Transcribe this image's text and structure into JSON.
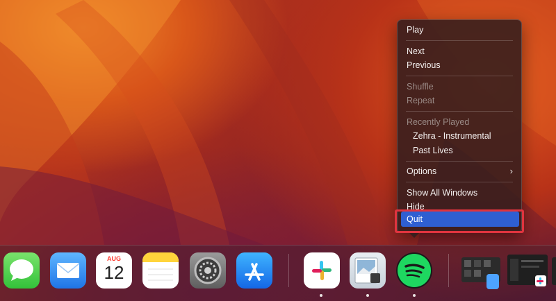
{
  "context_menu": {
    "play": "Play",
    "next": "Next",
    "previous": "Previous",
    "shuffle": "Shuffle",
    "repeat": "Repeat",
    "recently_played_header": "Recently Played",
    "recent_1": "Zehra - Instrumental",
    "recent_2": "Past Lives",
    "options": "Options",
    "options_arrow": "›",
    "show_all_windows": "Show All Windows",
    "hide": "Hide",
    "quit": "Quit"
  },
  "dock": {
    "apps": [
      {
        "name": "Messages",
        "icon": "messages-icon"
      },
      {
        "name": "Mail",
        "icon": "mail-icon"
      },
      {
        "name": "Calendar",
        "icon": "calendar-icon"
      },
      {
        "name": "Notes",
        "icon": "notes-icon"
      },
      {
        "name": "System Settings",
        "icon": "settings-icon"
      },
      {
        "name": "App Store",
        "icon": "app-store-icon"
      },
      {
        "name": "Slack",
        "icon": "slack-icon"
      },
      {
        "name": "Preview",
        "icon": "preview-icon"
      },
      {
        "name": "Spotify",
        "icon": "spotify-icon"
      }
    ],
    "calendar": {
      "month": "AUG",
      "day": "12"
    }
  },
  "colors": {
    "menu_highlight": "#2f5fd2",
    "annotation_box": "#e0343f",
    "spotify_green": "#1ed760"
  }
}
